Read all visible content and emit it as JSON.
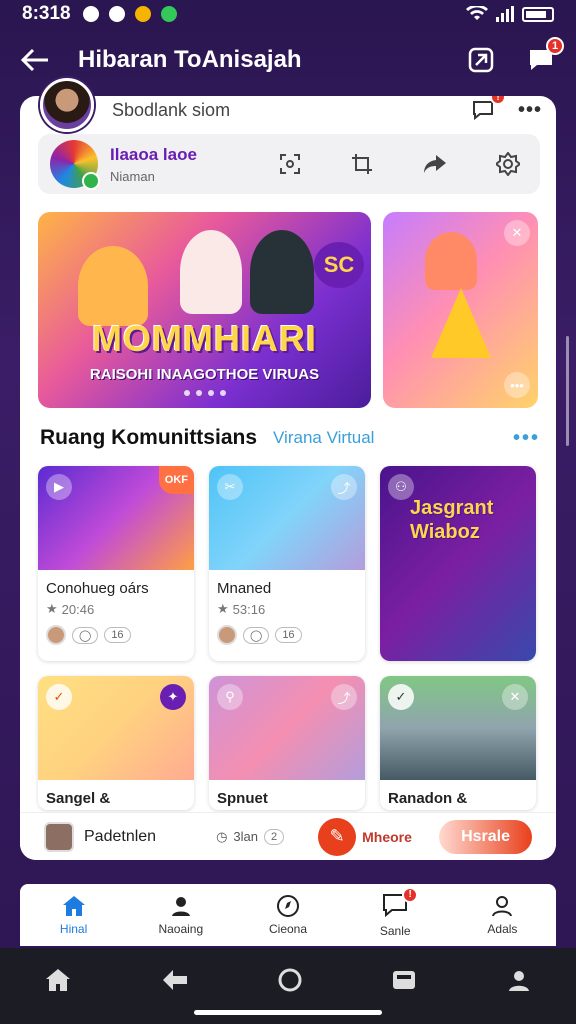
{
  "status_bar": {
    "time": "8:318"
  },
  "app_bar": {
    "title": "Hibaran ToAnisajah",
    "notification_count": "1"
  },
  "card": {
    "search_label": "Sbodlank siom",
    "search_badge": "!",
    "profile": {
      "name": "Ilaaoa laoe",
      "subtitle": "Niaman"
    },
    "banner": {
      "headline": "MOMMHIARI",
      "subline": "RAISOHI INAAGOTHOE VIRUAS"
    },
    "section": {
      "heading": "Ruang Komunittsians",
      "link": "Virana Virtual",
      "more": "•••"
    },
    "tiles": [
      {
        "title": "Conohueg oárs",
        "meta": "20:46",
        "pill": "16",
        "badge": "OKF"
      },
      {
        "title": "Mnaned",
        "meta": "53:16",
        "pill": "16"
      },
      {
        "title": "",
        "overlay": "Jasgrant Wiaboz"
      },
      {
        "title": "Sangel &"
      },
      {
        "title": "Spnuet"
      },
      {
        "title": "Ranadon &"
      }
    ],
    "action_bar": {
      "name": "Padetnlen",
      "count": "3lan",
      "count_badge": "2",
      "record_label": "Mheore",
      "button": "Hsrale"
    }
  },
  "bottom_nav": [
    {
      "label": "Hinal",
      "icon": "home-icon",
      "active": true
    },
    {
      "label": "Naoaing",
      "icon": "person-pin-icon"
    },
    {
      "label": "Cieona",
      "icon": "compass-icon"
    },
    {
      "label": "Sanle",
      "icon": "chat-icon",
      "badge": "!"
    },
    {
      "label": "Adals",
      "icon": "profile-icon"
    }
  ],
  "colors": {
    "accent": "#1e7be0",
    "brand": "#3a1d66",
    "record": "#e8401c"
  }
}
